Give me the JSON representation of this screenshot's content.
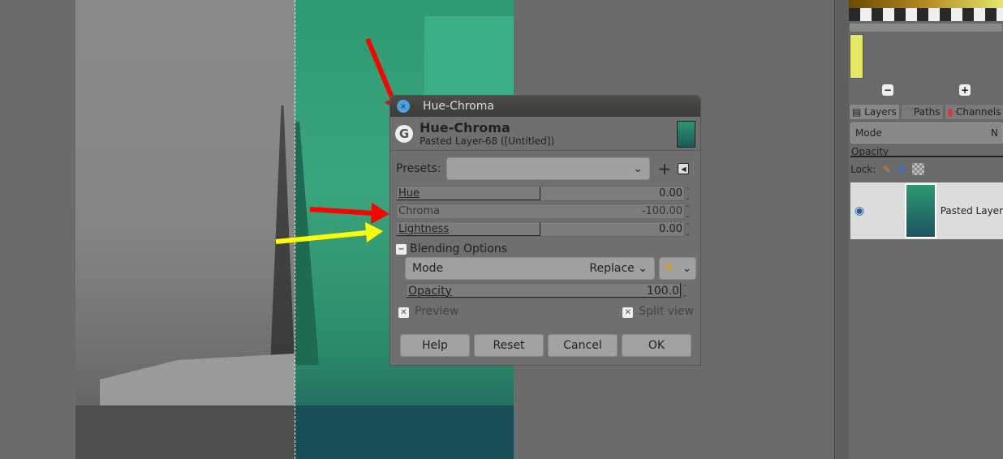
{
  "dialog": {
    "window_title": "Hue-Chroma",
    "title": "Hue-Chroma",
    "subtitle": "Pasted Layer-68 ([Untitled])",
    "presets_label": "Presets:",
    "presets_value": "",
    "sliders": [
      {
        "label": "Hue",
        "value": "0.00",
        "fill": 0.5
      },
      {
        "label": "Chroma",
        "value": "-100.00",
        "fill": 0.0
      },
      {
        "label": "Lightness",
        "value": "0.00",
        "fill": 0.5
      }
    ],
    "blending_label": "Blending Options",
    "mode_label": "Mode",
    "mode_value": "Replace",
    "opacity_label": "Opacity",
    "opacity_value": "100.0",
    "preview_label": "Preview",
    "split_label": "Split view",
    "buttons": [
      "Help",
      "Reset",
      "Cancel",
      "OK"
    ]
  },
  "dock": {
    "tabs": [
      "Layers",
      "Paths",
      "Channels"
    ],
    "mode_label": "Mode",
    "mode_value": "N",
    "opacity_label": "Opacity",
    "lock_label": "Lock:",
    "layer_name": "Pasted Layer"
  },
  "colors": {
    "arrow_red": "#ff0000",
    "arrow_yellow": "#ffff00",
    "swatch": "#e3e86a"
  }
}
